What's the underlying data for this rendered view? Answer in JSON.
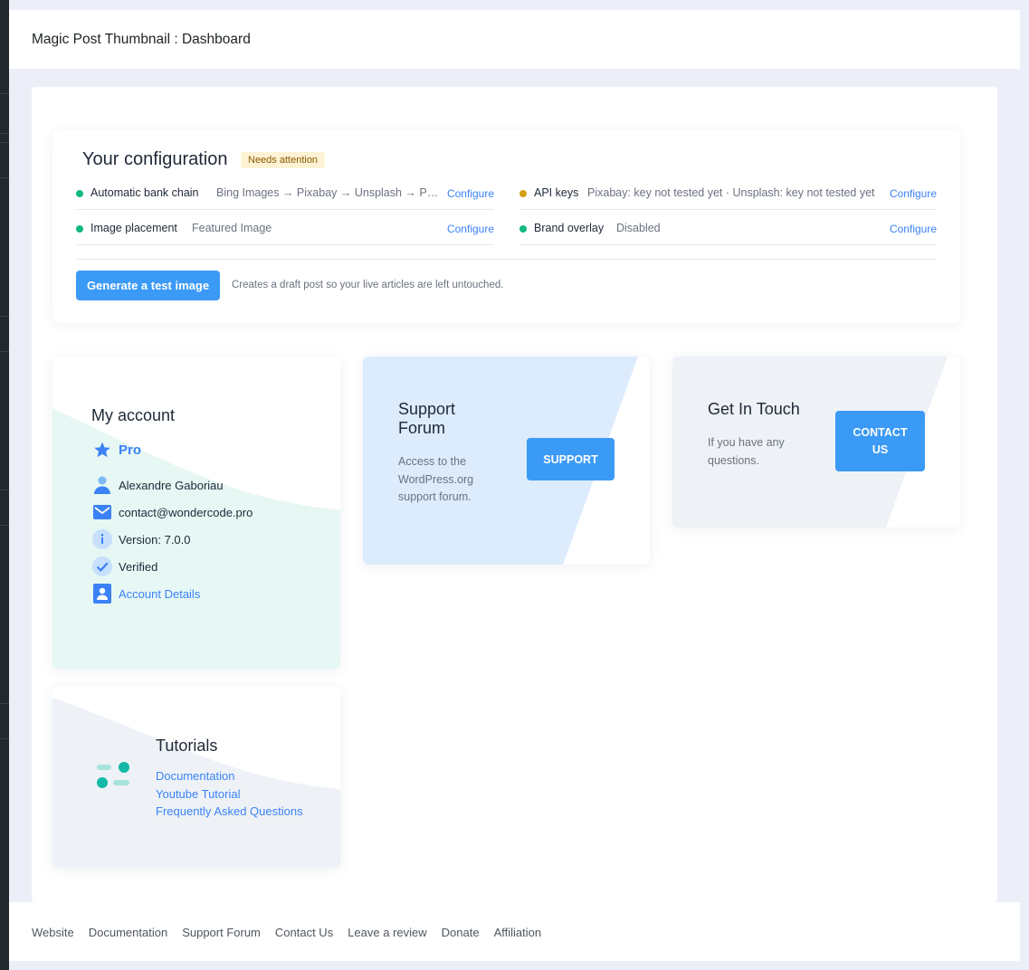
{
  "header": {
    "title": "Magic Post Thumbnail : Dashboard"
  },
  "config": {
    "title": "Your configuration",
    "badge": "Needs attention",
    "rows": [
      {
        "label": "Automatic bank chain",
        "value": "Bing Images → Pixabay → Unsplash → Pexels",
        "link": "Configure",
        "status_color": "#10b981"
      },
      {
        "label": "API keys",
        "value": "Pixabay: key not tested yet · Unsplash: key not tested yet",
        "link": "Configure",
        "status_color": "#d4a017"
      },
      {
        "label": "Image placement",
        "value": "Featured Image",
        "link": "Configure",
        "status_color": "#10b981"
      },
      {
        "label": "Brand overlay",
        "value": "Disabled",
        "link": "Configure",
        "status_color": "#10b981"
      }
    ],
    "generate_button": "Generate a test image",
    "generate_note": "Creates a draft post so your live articles are left untouched."
  },
  "account": {
    "title": "My account",
    "plan": "Pro",
    "name": "Alexandre Gaboriau",
    "email": "contact@wondercode.pro",
    "version": "Version: 7.0.0",
    "status": "Verified",
    "details_link": "Account Details"
  },
  "support": {
    "title": "Support Forum",
    "description": "Access to the WordPress.org support forum.",
    "button": "SUPPORT"
  },
  "touch": {
    "title": "Get In Touch",
    "description": "If you have any questions.",
    "button": "CONTACT US"
  },
  "tutorials": {
    "title": "Tutorials",
    "links": [
      "Documentation",
      "Youtube Tutorial",
      "Frequently Asked Questions"
    ]
  },
  "footer": {
    "links": [
      "Website",
      "Documentation",
      "Support Forum",
      "Contact Us",
      "Leave a review",
      "Donate",
      "Affiliation"
    ]
  },
  "colors": {
    "accent": "#3b9af5",
    "link": "#3b82f6",
    "ok": "#10b981",
    "warning": "#d4a017",
    "account_wave": "#e6f7f4",
    "support_bg": "#dcecfd",
    "touch_bg": "#eef2f7",
    "tutorial_bg": "#eef2f7"
  }
}
